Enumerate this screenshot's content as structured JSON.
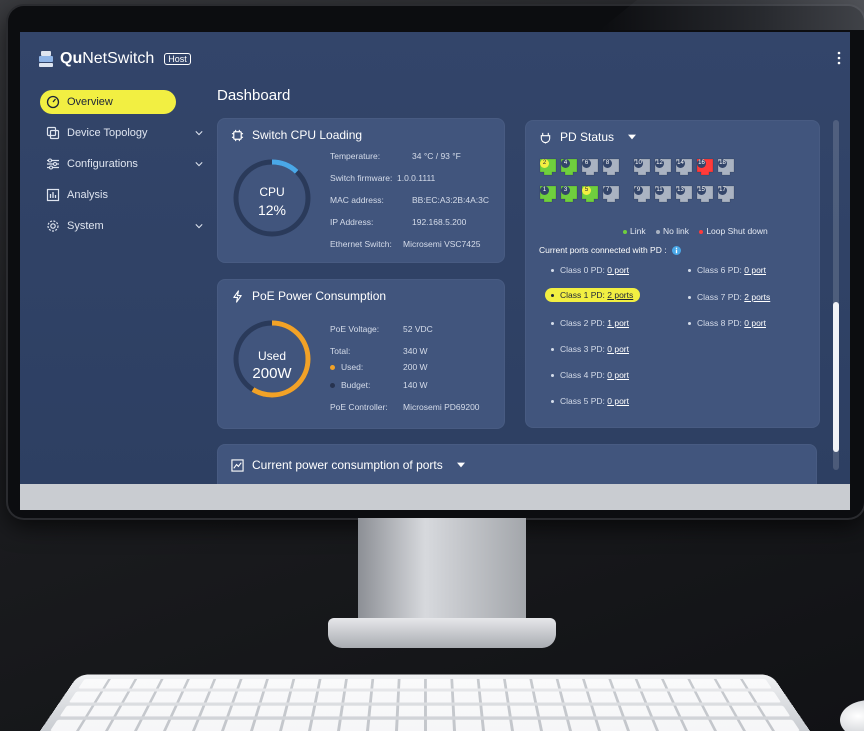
{
  "app": {
    "brand_bold": "Qu",
    "brand_rest": "NetSwitch",
    "badge": "Host"
  },
  "sidebar": {
    "items": [
      {
        "label": "Overview",
        "icon": "gauge-icon",
        "active": true
      },
      {
        "label": "Device Topology",
        "icon": "topology-icon",
        "expandable": true
      },
      {
        "label": "Configurations",
        "icon": "sliders-icon",
        "expandable": true
      },
      {
        "label": "Analysis",
        "icon": "bar-chart-icon"
      },
      {
        "label": "System",
        "icon": "gear-icon",
        "expandable": true
      }
    ]
  },
  "page": {
    "title": "Dashboard"
  },
  "cpu": {
    "title": "Switch CPU Loading",
    "gauge_label": "CPU",
    "gauge_value": "12%",
    "gauge_fraction": 0.12,
    "rows": [
      {
        "label": "Temperature:",
        "value": "34 °C / 93 °F"
      },
      {
        "label": "Switch firmware:",
        "value": "1.0.0.1111"
      },
      {
        "label": "MAC address:",
        "value": "BB:EC:A3:2B:4A:3C"
      },
      {
        "label": "IP Address:",
        "value": "192.168.5.200"
      },
      {
        "label": "Ethernet Switch:",
        "value": "Microsemi VSC7425"
      }
    ]
  },
  "poe": {
    "title": "PoE Power Consumption",
    "gauge_label": "Used",
    "gauge_value": "200W",
    "gauge_fraction": 0.588,
    "rows": [
      {
        "label": "PoE Voltage:",
        "value": "52 VDC"
      },
      {
        "label": "Total:",
        "value": "340 W"
      },
      {
        "label": "Used:",
        "value": "200 W"
      },
      {
        "label": "Budget:",
        "value": "140 W"
      },
      {
        "label": "PoE Controller:",
        "value": "Microsemi PD69200"
      }
    ],
    "used_color": "#f2a227",
    "budget_color": "#27334f"
  },
  "pd": {
    "title": "PD Status",
    "ports_top": [
      {
        "num": "2",
        "state": "link",
        "badge": "yellow"
      },
      {
        "num": "4",
        "state": "link"
      },
      {
        "num": "6",
        "state": "nolink"
      },
      {
        "num": "8",
        "state": "nolink"
      },
      {
        "num": "10",
        "state": "nolink"
      },
      {
        "num": "12",
        "state": "nolink"
      },
      {
        "num": "14",
        "state": "nolink"
      },
      {
        "num": "16",
        "state": "loop"
      },
      {
        "num": "18",
        "state": "nolink"
      }
    ],
    "ports_bottom": [
      {
        "num": "1",
        "state": "link"
      },
      {
        "num": "3",
        "state": "link"
      },
      {
        "num": "5",
        "state": "link",
        "badge": "yellow"
      },
      {
        "num": "7",
        "state": "nolink"
      },
      {
        "num": "9",
        "state": "nolink"
      },
      {
        "num": "11",
        "state": "nolink"
      },
      {
        "num": "13",
        "state": "nolink"
      },
      {
        "num": "15",
        "state": "nolink"
      },
      {
        "num": "17",
        "state": "nolink"
      }
    ],
    "legend": [
      {
        "label": "Link",
        "color": "#6fcf3e"
      },
      {
        "label": "No link",
        "color": "#aab3c2"
      },
      {
        "label": "Loop Shut down",
        "color": "#ff3b3b"
      }
    ],
    "connected_label": "Current ports connected with PD :",
    "classes_left": [
      {
        "label": "Class 0 PD:",
        "link": "0 port"
      },
      {
        "label": "Class 1 PD:",
        "link": "2 ports",
        "highlight": true
      },
      {
        "label": "Class 2 PD:",
        "link": "1 port"
      },
      {
        "label": "Class 3 PD:",
        "link": "0 port"
      },
      {
        "label": "Class 4 PD:",
        "link": "0 port"
      },
      {
        "label": "Class 5 PD:",
        "link": "0 port"
      }
    ],
    "classes_right": [
      {
        "label": "Class 6 PD:",
        "link": "0 port"
      },
      {
        "label": "Class 7 PD:",
        "link": "2 ports"
      },
      {
        "label": "Class 8 PD:",
        "link": "0 port"
      }
    ]
  },
  "bottom_card": {
    "title": "Current power consumption of ports"
  },
  "colors": {
    "accent": "#f2ef42",
    "link_green": "#6fcf3e",
    "nolink_gray": "#aab3c2",
    "loop_red": "#ff3b3b",
    "cpu_arc": "#4aa8e8",
    "poe_arc": "#f2a227"
  }
}
